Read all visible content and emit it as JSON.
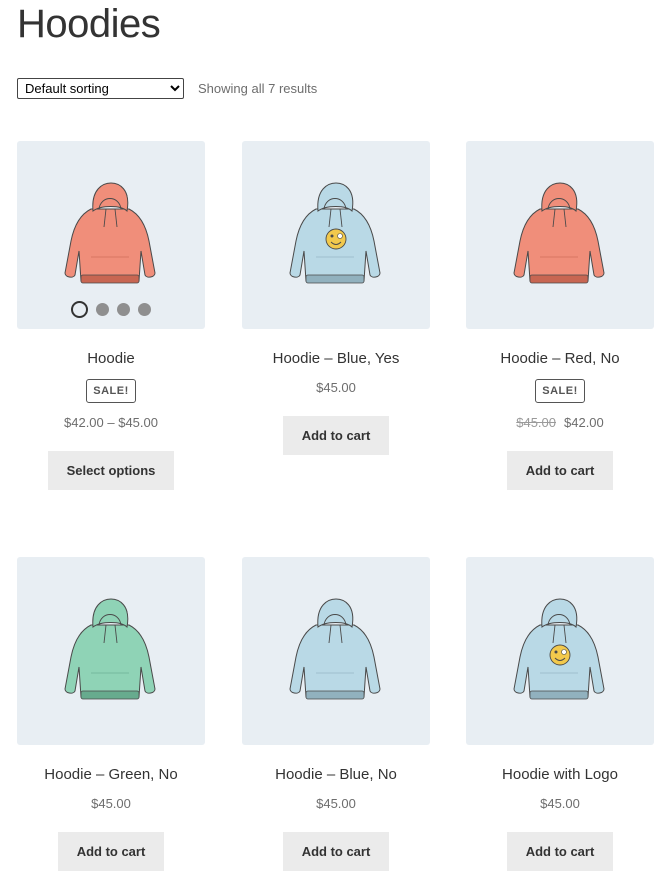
{
  "page": {
    "title": "Hoodies",
    "sorting": {
      "selected": "Default sorting"
    },
    "result_count": "Showing all 7 results"
  },
  "products": [
    {
      "title": "Hoodie",
      "badge": "SALE!",
      "price": "$42.00 – $45.00",
      "button": "Select options",
      "color": "#f08e7a",
      "logo": false,
      "gallery_dots": 4
    },
    {
      "title": "Hoodie – Blue, Yes",
      "price": "$45.00",
      "button": "Add to cart",
      "color": "#b9d9e6",
      "logo": true
    },
    {
      "title": "Hoodie – Red, No",
      "badge": "SALE!",
      "old_price": "$45.00",
      "new_price": "$42.00",
      "button": "Add to cart",
      "color": "#f08e7a",
      "logo": false
    },
    {
      "title": "Hoodie – Green, No",
      "price": "$45.00",
      "button": "Add to cart",
      "color": "#8fd3b6",
      "logo": false
    },
    {
      "title": "Hoodie – Blue, No",
      "price": "$45.00",
      "button": "Add to cart",
      "color": "#b9d9e6",
      "logo": false
    },
    {
      "title": "Hoodie with Logo",
      "price": "$45.00",
      "button": "Add to cart",
      "color": "#b9d9e6",
      "logo": true
    }
  ]
}
